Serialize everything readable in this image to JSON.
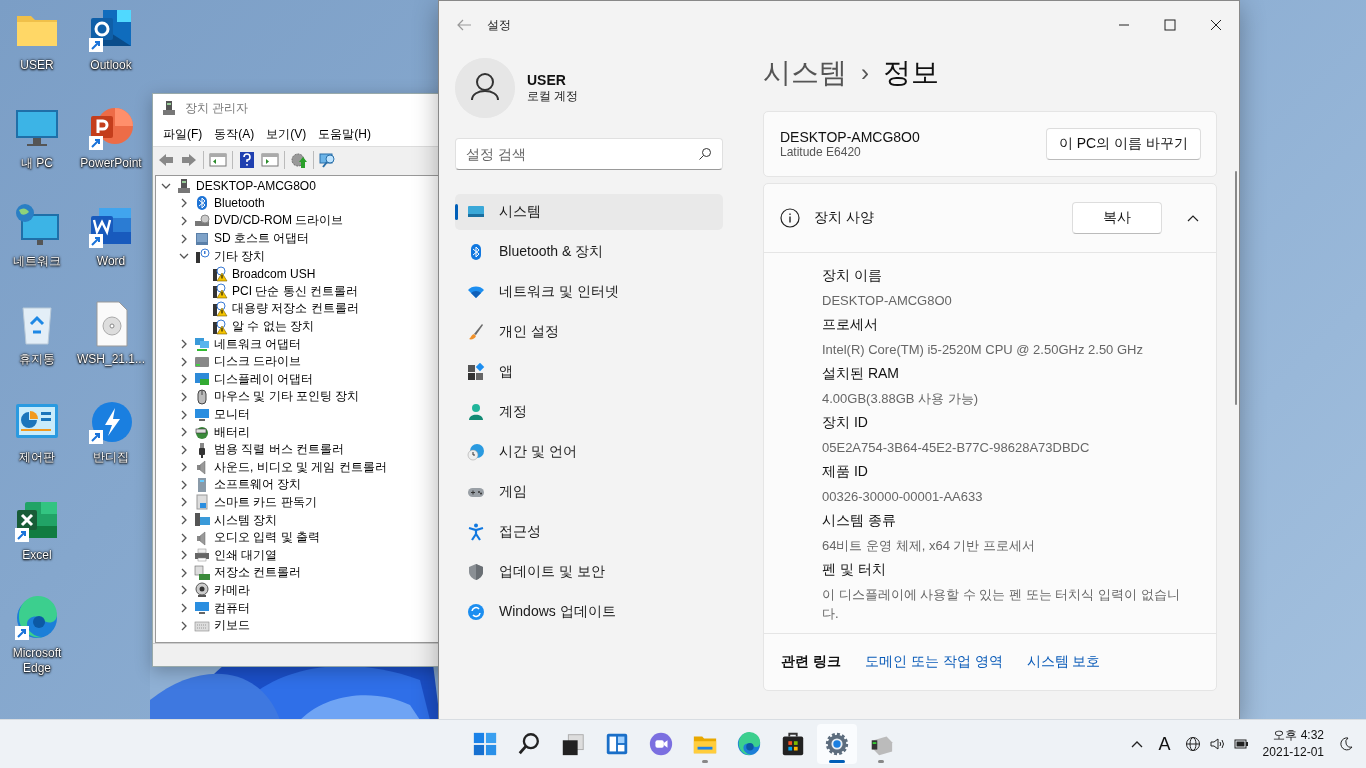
{
  "desktop_icons": [
    {
      "label": "USER",
      "kind": "folder",
      "shortcut": false
    },
    {
      "label": "내 PC",
      "kind": "pc",
      "shortcut": false
    },
    {
      "label": "네트워크",
      "kind": "network",
      "shortcut": false
    },
    {
      "label": "휴지통",
      "kind": "recycle",
      "shortcut": false
    },
    {
      "label": "제어판",
      "kind": "control-panel",
      "shortcut": false
    },
    {
      "label": "Excel",
      "kind": "excel",
      "shortcut": true
    },
    {
      "label": "Microsoft Edge",
      "kind": "edge",
      "shortcut": true
    },
    {
      "label": "Outlook",
      "kind": "outlook",
      "shortcut": true
    },
    {
      "label": "PowerPoint",
      "kind": "powerpoint",
      "shortcut": true
    },
    {
      "label": "Word",
      "kind": "word",
      "shortcut": true
    },
    {
      "label": "WSH_21.1...",
      "kind": "disc-file",
      "shortcut": false
    },
    {
      "label": "반디집",
      "kind": "bandizip",
      "shortcut": true
    }
  ],
  "device_manager": {
    "title": "장치 관리자",
    "menu": [
      "파일(F)",
      "동작(A)",
      "보기(V)",
      "도움말(H)"
    ],
    "tree": {
      "label": "DESKTOP-AMCG8O0",
      "kind": "computer",
      "expanded": true,
      "children": [
        {
          "label": "Bluetooth",
          "kind": "bluetooth",
          "expanded": false
        },
        {
          "label": "DVD/CD-ROM 드라이브",
          "kind": "dvd",
          "expanded": false
        },
        {
          "label": "SD 호스트 어댑터",
          "kind": "card",
          "expanded": false
        },
        {
          "label": "기타 장치",
          "kind": "unknown",
          "expanded": true,
          "children": [
            {
              "label": "Broadcom USH",
              "kind": "warning"
            },
            {
              "label": "PCI 단순 통신 컨트롤러",
              "kind": "warning"
            },
            {
              "label": "대용량 저장소 컨트롤러",
              "kind": "warning"
            },
            {
              "label": "알 수 없는 장치",
              "kind": "warning"
            }
          ]
        },
        {
          "label": "네트워크 어댑터",
          "kind": "network",
          "expanded": false
        },
        {
          "label": "디스크 드라이브",
          "kind": "disk",
          "expanded": false
        },
        {
          "label": "디스플레이 어댑터",
          "kind": "display",
          "expanded": false
        },
        {
          "label": "마우스 및 기타 포인팅 장치",
          "kind": "mouse",
          "expanded": false
        },
        {
          "label": "모니터",
          "kind": "monitor",
          "expanded": false
        },
        {
          "label": "배터리",
          "kind": "battery",
          "expanded": false
        },
        {
          "label": "범용 직렬 버스 컨트롤러",
          "kind": "usb",
          "expanded": false
        },
        {
          "label": "사운드, 비디오 및 게임 컨트롤러",
          "kind": "sound",
          "expanded": false
        },
        {
          "label": "소프트웨어 장치",
          "kind": "software",
          "expanded": false
        },
        {
          "label": "스마트 카드 판독기",
          "kind": "smartcard",
          "expanded": false
        },
        {
          "label": "시스템 장치",
          "kind": "system",
          "expanded": false
        },
        {
          "label": "오디오 입력 및 출력",
          "kind": "sound",
          "expanded": false
        },
        {
          "label": "인쇄 대기열",
          "kind": "printer",
          "expanded": false
        },
        {
          "label": "저장소 컨트롤러",
          "kind": "storage",
          "expanded": false
        },
        {
          "label": "카메라",
          "kind": "camera",
          "expanded": false
        },
        {
          "label": "컴퓨터",
          "kind": "monitor",
          "expanded": false
        },
        {
          "label": "키보드",
          "kind": "keyboard",
          "expanded": false
        }
      ]
    }
  },
  "settings": {
    "title": "설정",
    "user": {
      "name": "USER",
      "account": "로컬 계정"
    },
    "search": {
      "placeholder": "설정 검색"
    },
    "nav": [
      {
        "label": "시스템",
        "kind": "system",
        "selected": true
      },
      {
        "label": "Bluetooth & 장치",
        "kind": "bluetooth",
        "selected": false
      },
      {
        "label": "네트워크 및 인터넷",
        "kind": "network",
        "selected": false
      },
      {
        "label": "개인 설정",
        "kind": "personalize",
        "selected": false
      },
      {
        "label": "앱",
        "kind": "apps",
        "selected": false
      },
      {
        "label": "계정",
        "kind": "accounts",
        "selected": false
      },
      {
        "label": "시간 및 언어",
        "kind": "time",
        "selected": false
      },
      {
        "label": "게임",
        "kind": "gaming",
        "selected": false
      },
      {
        "label": "접근성",
        "kind": "accessibility",
        "selected": false
      },
      {
        "label": "업데이트 및 보안",
        "kind": "security",
        "selected": false
      },
      {
        "label": "Windows 업데이트",
        "kind": "update",
        "selected": false
      }
    ],
    "breadcrumb": {
      "parent": "시스템",
      "separator": "›",
      "current": "정보"
    },
    "device_card": {
      "name": "DESKTOP-AMCG8O0",
      "model": "Latitude E6420",
      "rename_button": "이 PC의 이름 바꾸기"
    },
    "specs": {
      "title": "장치 사양",
      "copy_button": "복사",
      "expanded": true,
      "items": [
        {
          "label": "장치 이름",
          "value": "DESKTOP-AMCG8O0"
        },
        {
          "label": "프로세서",
          "value": "Intel(R) Core(TM) i5-2520M CPU @ 2.50GHz   2.50 GHz"
        },
        {
          "label": "설치된 RAM",
          "value": "4.00GB(3.88GB 사용 가능)"
        },
        {
          "label": "장치 ID",
          "value": "05E2A754-3B64-45E2-B77C-98628A73DBDC"
        },
        {
          "label": "제품 ID",
          "value": "00326-30000-00001-AA633"
        },
        {
          "label": "시스템 종류",
          "value": "64비트 운영 체제, x64 기반 프로세서"
        },
        {
          "label": "펜 및 터치",
          "value": "이 디스플레이에 사용할 수 있는 펜 또는 터치식 입력이 없습니다."
        }
      ]
    },
    "related": {
      "label": "관련 링크",
      "links": [
        "도메인 또는 작업 영역",
        "시스템 보호"
      ]
    }
  },
  "taskbar": {
    "apps": [
      {
        "kind": "start",
        "running": false,
        "selected": false
      },
      {
        "kind": "search",
        "running": false,
        "selected": false
      },
      {
        "kind": "task-view",
        "running": false,
        "selected": false
      },
      {
        "kind": "widgets",
        "running": false,
        "selected": false
      },
      {
        "kind": "chat",
        "running": false,
        "selected": false
      },
      {
        "kind": "explorer",
        "running": true,
        "selected": false
      },
      {
        "kind": "edge",
        "running": false,
        "selected": false
      },
      {
        "kind": "store",
        "running": false,
        "selected": false
      },
      {
        "kind": "settings",
        "running": true,
        "selected": true
      },
      {
        "kind": "device-manager",
        "running": true,
        "selected": false
      }
    ],
    "tray": {
      "ime": "A",
      "time": "오후 4:32",
      "date": "2021-12-01"
    }
  }
}
